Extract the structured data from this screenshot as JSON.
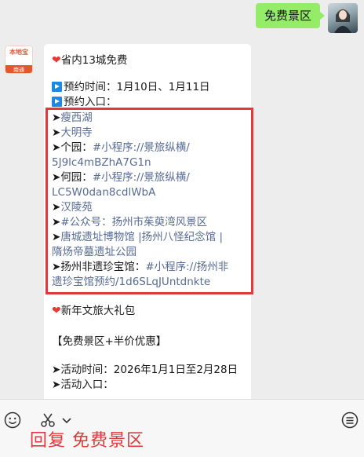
{
  "user_message": {
    "text": "免费景区"
  },
  "bot": {
    "avatar_line1": "本地宝",
    "avatar_line2": "南通"
  },
  "message": {
    "lines": [
      {
        "type": "heading",
        "text": "省内13城免费"
      },
      {
        "type": "plain",
        "prefix": "",
        "text": "预约时间：1月10日、1月11日"
      },
      {
        "type": "plain",
        "prefix": "",
        "text": "预约入口："
      },
      {
        "type": "plain",
        "prefix": "➤",
        "text": "瘦西湖",
        "link": true
      },
      {
        "type": "plain",
        "prefix": "➤",
        "text": "大明寺",
        "link": true
      },
      {
        "type": "mixed",
        "prefix": "➤",
        "text": "个园：",
        "link_text": "#小程序://景旅纵横/"
      },
      {
        "type": "plain",
        "prefix": "",
        "text": "5J9lc4mBZhA7G1n",
        "link": true
      },
      {
        "type": "mixed",
        "prefix": "➤",
        "text": "何园：",
        "link_text": "#小程序://景旅纵横/"
      },
      {
        "type": "plain",
        "prefix": "",
        "text": "LC5W0dan8cdlWbA",
        "link": true
      },
      {
        "type": "plain",
        "prefix": "➤",
        "text": "汉陵苑",
        "link": true
      },
      {
        "type": "plain",
        "prefix": "➤",
        "text": "#公众号：扬州市茱萸湾风景区",
        "link": true
      },
      {
        "type": "plain",
        "prefix": "➤",
        "text": "唐城遗址博物馆 |扬州八怪纪念馆 |",
        "link": true
      },
      {
        "type": "plain",
        "prefix": "",
        "text": "隋炀帝墓遗址公园",
        "link": true
      },
      {
        "type": "mixed",
        "prefix": "➤",
        "text": "扬州非遗珍宝馆：",
        "link_text": "#小程序://扬州非"
      },
      {
        "type": "plain",
        "prefix": "",
        "text": "遗珍宝馆预约/1d6SLqJUntdnkte",
        "link": true
      },
      {
        "type": "heading",
        "text": "新年文旅大礼包"
      },
      {
        "type": "plain",
        "prefix": "",
        "text": "【免费景区+半价优惠】"
      },
      {
        "type": "plain",
        "prefix": "➤",
        "text": "活动时间：2026年1月1日至2月28日"
      },
      {
        "type": "plain",
        "prefix": "➤",
        "text": "活动入口："
      }
    ]
  },
  "caption": {
    "text": "回复 免费景区"
  },
  "icons": {
    "emoji": "emoji-icon",
    "scissors": "scissors-icon",
    "menu": "menu-icon"
  }
}
